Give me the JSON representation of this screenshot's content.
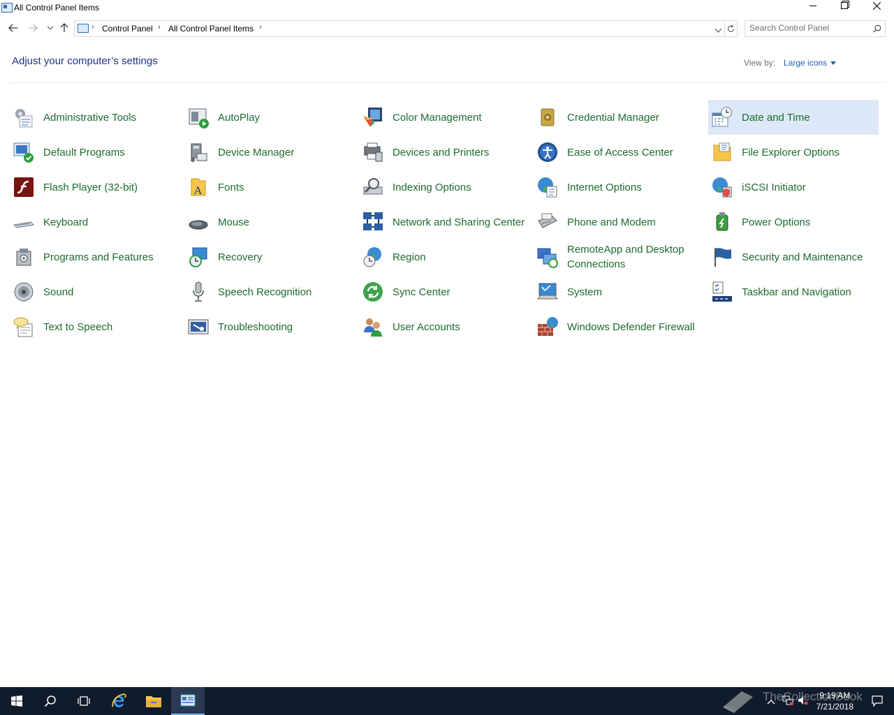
{
  "window": {
    "title": "All Control Panel Items",
    "icons": {
      "minimize": "minimize-icon",
      "maximize": "restore-icon",
      "close": "close-icon"
    }
  },
  "nav": {
    "breadcrumbs": [
      "Control Panel",
      "All Control Panel Items"
    ],
    "search_placeholder": "Search Control Panel"
  },
  "header": {
    "title": "Adjust your computer’s settings",
    "view_by_label": "View by:",
    "view_by_value": "Large icons"
  },
  "items": [
    {
      "label": "Administrative Tools",
      "icon": "administrative-tools-icon"
    },
    {
      "label": "AutoPlay",
      "icon": "autoplay-icon"
    },
    {
      "label": "Color Management",
      "icon": "color-management-icon"
    },
    {
      "label": "Credential Manager",
      "icon": "credential-manager-icon"
    },
    {
      "label": "Date and Time",
      "icon": "date-and-time-icon",
      "selected": true
    },
    {
      "label": "Default Programs",
      "icon": "default-programs-icon"
    },
    {
      "label": "Device Manager",
      "icon": "device-manager-icon"
    },
    {
      "label": "Devices and Printers",
      "icon": "devices-and-printers-icon"
    },
    {
      "label": "Ease of Access Center",
      "icon": "ease-of-access-icon"
    },
    {
      "label": "File Explorer Options",
      "icon": "file-explorer-options-icon"
    },
    {
      "label": "Flash Player (32-bit)",
      "icon": "flash-player-icon"
    },
    {
      "label": "Fonts",
      "icon": "fonts-icon"
    },
    {
      "label": "Indexing Options",
      "icon": "indexing-options-icon"
    },
    {
      "label": "Internet Options",
      "icon": "internet-options-icon"
    },
    {
      "label": "iSCSI Initiator",
      "icon": "iscsi-initiator-icon"
    },
    {
      "label": "Keyboard",
      "icon": "keyboard-icon"
    },
    {
      "label": "Mouse",
      "icon": "mouse-icon"
    },
    {
      "label": "Network and Sharing Center",
      "icon": "network-sharing-icon"
    },
    {
      "label": "Phone and Modem",
      "icon": "phone-modem-icon"
    },
    {
      "label": "Power Options",
      "icon": "power-options-icon"
    },
    {
      "label": "Programs and Features",
      "icon": "programs-features-icon"
    },
    {
      "label": "Recovery",
      "icon": "recovery-icon"
    },
    {
      "label": "Region",
      "icon": "region-icon"
    },
    {
      "label": "RemoteApp and Desktop Connections",
      "icon": "remoteapp-icon"
    },
    {
      "label": "Security and Maintenance",
      "icon": "security-maintenance-icon"
    },
    {
      "label": "Sound",
      "icon": "sound-icon"
    },
    {
      "label": "Speech Recognition",
      "icon": "speech-recognition-icon"
    },
    {
      "label": "Sync Center",
      "icon": "sync-center-icon"
    },
    {
      "label": "System",
      "icon": "system-icon"
    },
    {
      "label": "Taskbar and Navigation",
      "icon": "taskbar-navigation-icon"
    },
    {
      "label": "Text to Speech",
      "icon": "text-to-speech-icon"
    },
    {
      "label": "Troubleshooting",
      "icon": "troubleshooting-icon"
    },
    {
      "label": "User Accounts",
      "icon": "user-accounts-icon"
    },
    {
      "label": "Windows Defender Firewall",
      "icon": "firewall-icon"
    }
  ],
  "taskbar": {
    "time": "9:19 AM",
    "date": "7/21/2018",
    "watermark": "TheCollectionBook"
  },
  "colors": {
    "item_label": "#1d6a2f",
    "title": "#1e3287",
    "link": "#1e5fab",
    "selected_bg": "#dde9f8",
    "taskbar_bg": "#101c2c"
  }
}
